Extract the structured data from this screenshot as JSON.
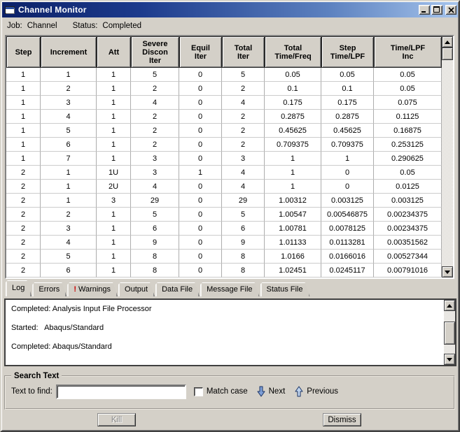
{
  "window": {
    "title": "Channel Monitor"
  },
  "job_status": {
    "job_label": "Job:",
    "job_value": "Channel",
    "status_label": "Status:",
    "status_value": "Completed"
  },
  "table": {
    "columns": [
      "Step",
      "Increment",
      "Att",
      "Severe\nDiscon\nIter",
      "Equil\nIter",
      "Total\nIter",
      "Total\nTime/Freq",
      "Step\nTime/LPF",
      "Time/LPF\nInc"
    ],
    "rows": [
      [
        "1",
        "1",
        "1",
        "5",
        "0",
        "5",
        "0.05",
        "0.05",
        "0.05"
      ],
      [
        "1",
        "2",
        "1",
        "2",
        "0",
        "2",
        "0.1",
        "0.1",
        "0.05"
      ],
      [
        "1",
        "3",
        "1",
        "4",
        "0",
        "4",
        "0.175",
        "0.175",
        "0.075"
      ],
      [
        "1",
        "4",
        "1",
        "2",
        "0",
        "2",
        "0.2875",
        "0.2875",
        "0.1125"
      ],
      [
        "1",
        "5",
        "1",
        "2",
        "0",
        "2",
        "0.45625",
        "0.45625",
        "0.16875"
      ],
      [
        "1",
        "6",
        "1",
        "2",
        "0",
        "2",
        "0.709375",
        "0.709375",
        "0.253125"
      ],
      [
        "1",
        "7",
        "1",
        "3",
        "0",
        "3",
        "1",
        "1",
        "0.290625"
      ],
      [
        "2",
        "1",
        "1U",
        "3",
        "1",
        "4",
        "1",
        "0",
        "0.05"
      ],
      [
        "2",
        "1",
        "2U",
        "4",
        "0",
        "4",
        "1",
        "0",
        "0.0125"
      ],
      [
        "2",
        "1",
        "3",
        "29",
        "0",
        "29",
        "1.00312",
        "0.003125",
        "0.003125"
      ],
      [
        "2",
        "2",
        "1",
        "5",
        "0",
        "5",
        "1.00547",
        "0.00546875",
        "0.00234375"
      ],
      [
        "2",
        "3",
        "1",
        "6",
        "0",
        "6",
        "1.00781",
        "0.0078125",
        "0.00234375"
      ],
      [
        "2",
        "4",
        "1",
        "9",
        "0",
        "9",
        "1.01133",
        "0.0113281",
        "0.00351562"
      ],
      [
        "2",
        "5",
        "1",
        "8",
        "0",
        "8",
        "1.0166",
        "0.0166016",
        "0.00527344"
      ],
      [
        "2",
        "6",
        "1",
        "8",
        "0",
        "8",
        "1.02451",
        "0.0245117",
        "0.00791016"
      ]
    ]
  },
  "tabs": [
    {
      "label": "Log",
      "active": true
    },
    {
      "label": "Errors",
      "active": false
    },
    {
      "label": "Warnings",
      "active": false,
      "prefix": "!"
    },
    {
      "label": "Output",
      "active": false
    },
    {
      "label": "Data File",
      "active": false
    },
    {
      "label": "Message File",
      "active": false
    },
    {
      "label": "Status File",
      "active": false
    }
  ],
  "log": {
    "lines": [
      "Completed: Analysis Input File Processor",
      "",
      "Started:   Abaqus/Standard",
      "",
      "Completed: Abaqus/Standard"
    ]
  },
  "search": {
    "legend": "Search Text",
    "find_label": "Text to find:",
    "find_value": "",
    "match_case_label": "Match case",
    "match_case_checked": false,
    "next_label": "Next",
    "previous_label": "Previous"
  },
  "footer": {
    "kill_label": "Kill",
    "kill_enabled": false,
    "dismiss_label": "Dismiss"
  },
  "icons": {
    "app": "window-icon",
    "minimize": "_",
    "maximize": "□",
    "close": "×",
    "next": "down-arrow",
    "previous": "up-arrow",
    "warning": "!"
  },
  "colors": {
    "window_bg": "#d4d0c8",
    "titlebar_start": "#0c2168",
    "titlebar_end": "#a6c4ec",
    "warning_red": "#cc0000",
    "table_bg": "#ffffff",
    "arrow_blue_fill": "#7d9ed6",
    "arrow_blue_light": "#bfd4ee"
  }
}
